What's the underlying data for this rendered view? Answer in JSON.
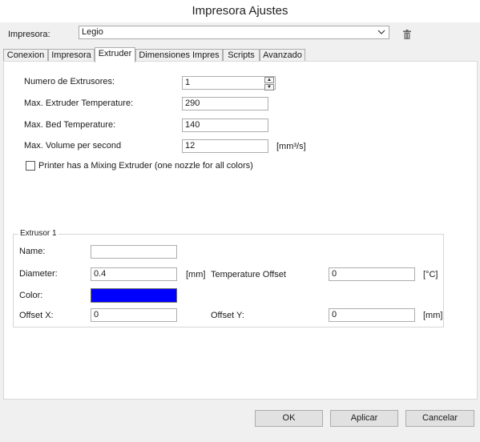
{
  "window": {
    "title": "Impresora Ajustes"
  },
  "printer": {
    "label": "Impresora:",
    "selected": "Legio"
  },
  "icons": {
    "dropdown": "chevron-down-icon",
    "delete": "trash-icon"
  },
  "tabs": [
    {
      "label": "Conexion"
    },
    {
      "label": "Impresora"
    },
    {
      "label": "Extruder",
      "active": true
    },
    {
      "label": "Dimensiones Impres"
    },
    {
      "label": "Scripts"
    },
    {
      "label": "Avanzado"
    }
  ],
  "extruder": {
    "num_label": "Numero de Extrusores:",
    "num_value": "1",
    "max_temp_label": "Max. Extruder Temperature:",
    "max_temp_value": "290",
    "max_bed_label": "Max. Bed Temperature:",
    "max_bed_value": "140",
    "max_volume_label": "Max. Volume per second",
    "max_volume_value": "12",
    "max_volume_unit": "[mm³/s]",
    "mixing_label": "Printer has a Mixing Extruder (one nozzle for all colors)",
    "mixing_checked": false
  },
  "extrusor1": {
    "legend": "Extrusor 1",
    "name_label": "Name:",
    "name_value": "",
    "diameter_label": "Diameter:",
    "diameter_value": "0.4",
    "diameter_unit": "[mm]",
    "temp_offset_label": "Temperature Offset",
    "temp_offset_value": "0",
    "temp_offset_unit": "[°C]",
    "color_label": "Color:",
    "color_value": "#0000ff",
    "offsetx_label": "Offset X:",
    "offsetx_value": "0",
    "offsety_label": "Offset Y:",
    "offsety_value": "0",
    "offsety_unit": "[mm]"
  },
  "buttons": {
    "ok": "OK",
    "apply": "Aplicar",
    "cancel": "Cancelar"
  }
}
